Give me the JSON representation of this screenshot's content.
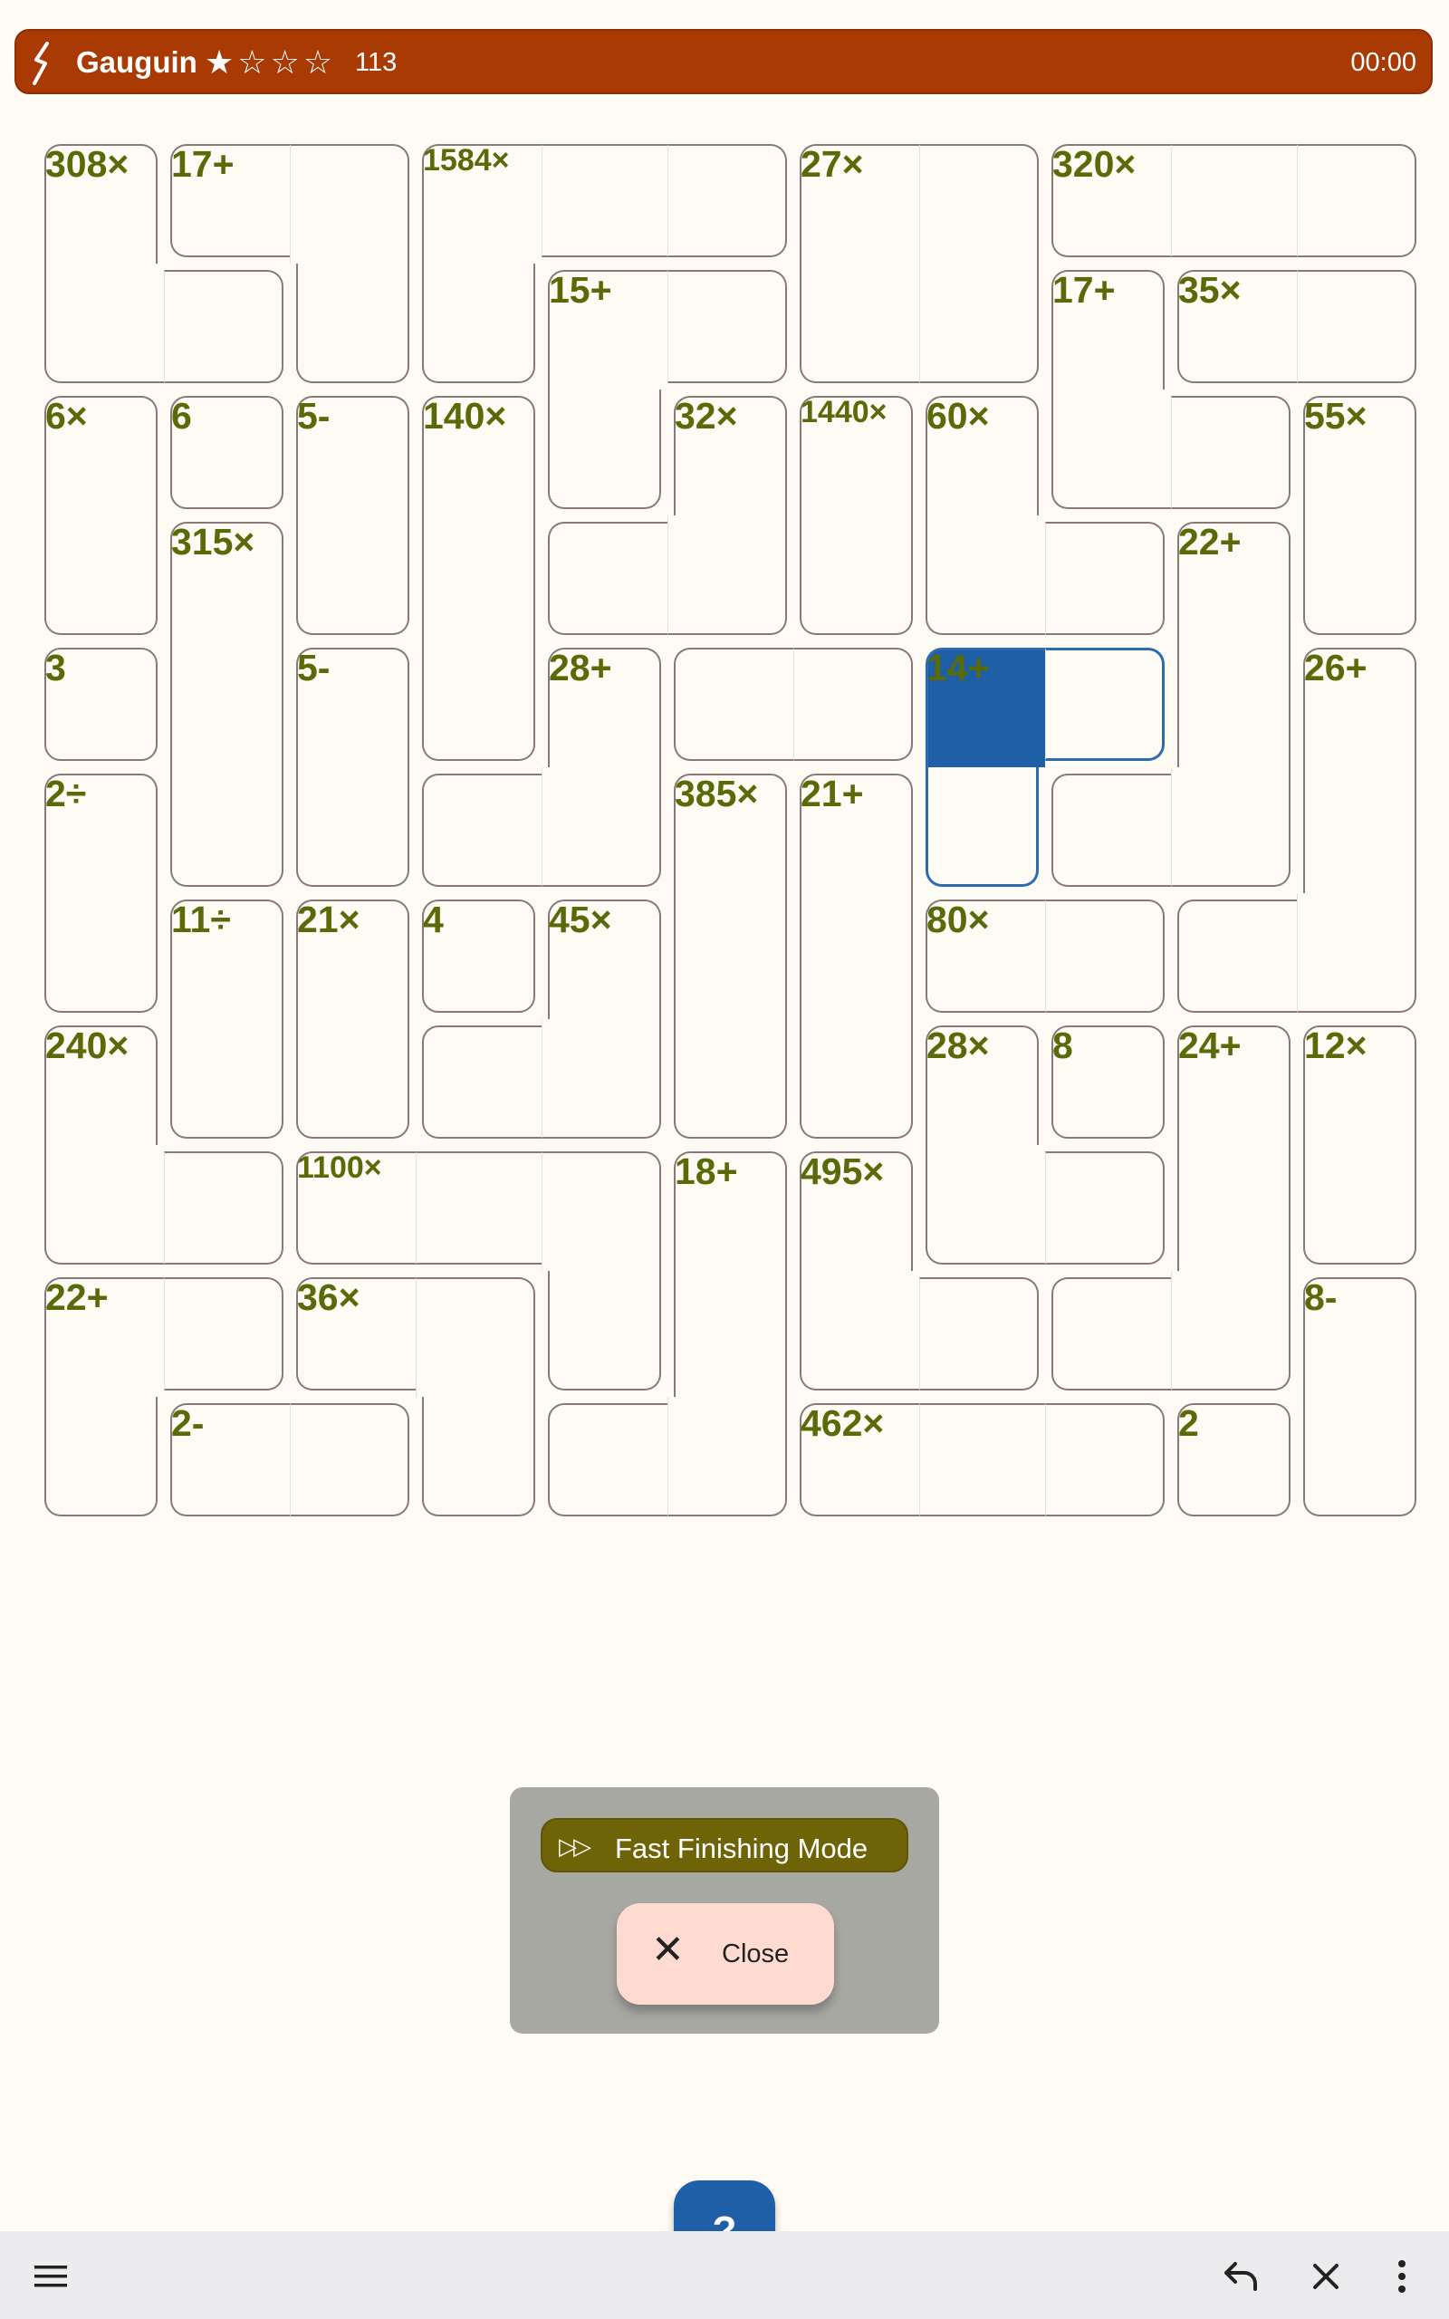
{
  "app": {
    "title": "Gauguin",
    "stars": "★☆☆☆",
    "count": "113",
    "timer": "00:00",
    "colors": {
      "bar": "#a93a03",
      "background": "#fdfbf4",
      "cage_label": "#5a6a08",
      "selected_cell": "#1f5fa8",
      "selected_cage_border": "#2c6bb0"
    }
  },
  "puzzle": {
    "size": 11,
    "selected_cell": {
      "row": 4,
      "col": 7
    },
    "cages": [
      {
        "label": "308×",
        "cells": [
          [
            0,
            0
          ],
          [
            1,
            0
          ],
          [
            1,
            1
          ]
        ]
      },
      {
        "label": "17+",
        "cells": [
          [
            0,
            1
          ],
          [
            0,
            2
          ],
          [
            1,
            2
          ]
        ]
      },
      {
        "label": "1584×",
        "cells": [
          [
            0,
            3
          ],
          [
            0,
            4
          ],
          [
            0,
            5
          ],
          [
            1,
            3
          ]
        ]
      },
      {
        "label": "27×",
        "cells": [
          [
            0,
            6
          ],
          [
            0,
            7
          ],
          [
            1,
            6
          ],
          [
            1,
            7
          ]
        ]
      },
      {
        "label": "320×",
        "cells": [
          [
            0,
            8
          ],
          [
            0,
            9
          ],
          [
            0,
            10
          ]
        ]
      },
      {
        "label": "15+",
        "cells": [
          [
            1,
            4
          ],
          [
            1,
            5
          ],
          [
            2,
            4
          ]
        ]
      },
      {
        "label": "17+",
        "cells": [
          [
            1,
            8
          ],
          [
            2,
            8
          ],
          [
            2,
            9
          ]
        ]
      },
      {
        "label": "35×",
        "cells": [
          [
            1,
            9
          ],
          [
            1,
            10
          ]
        ]
      },
      {
        "label": "6×",
        "cells": [
          [
            2,
            0
          ],
          [
            3,
            0
          ]
        ]
      },
      {
        "label": "6",
        "cells": [
          [
            2,
            1
          ]
        ]
      },
      {
        "label": "5-",
        "cells": [
          [
            2,
            2
          ],
          [
            3,
            2
          ]
        ]
      },
      {
        "label": "140×",
        "cells": [
          [
            2,
            3
          ],
          [
            3,
            3
          ],
          [
            4,
            3
          ]
        ]
      },
      {
        "label": "32×",
        "cells": [
          [
            2,
            5
          ],
          [
            3,
            4
          ],
          [
            3,
            5
          ]
        ]
      },
      {
        "label": "1440×",
        "cells": [
          [
            2,
            6
          ],
          [
            3,
            6
          ]
        ]
      },
      {
        "label": "60×",
        "cells": [
          [
            2,
            7
          ],
          [
            3,
            7
          ],
          [
            3,
            8
          ]
        ]
      },
      {
        "label": "55×",
        "cells": [
          [
            2,
            10
          ],
          [
            3,
            10
          ]
        ]
      },
      {
        "label": "315×",
        "cells": [
          [
            3,
            1
          ],
          [
            4,
            1
          ],
          [
            5,
            1
          ]
        ]
      },
      {
        "label": "22+",
        "cells": [
          [
            3,
            9
          ],
          [
            4,
            9
          ],
          [
            5,
            9
          ],
          [
            5,
            8
          ],
          [
            5,
            7
          ]
        ]
      },
      {
        "label": "3",
        "cells": [
          [
            4,
            0
          ]
        ]
      },
      {
        "label": "5-",
        "cells": [
          [
            4,
            2
          ],
          [
            5,
            2
          ]
        ]
      },
      {
        "label": "28+",
        "cells": [
          [
            4,
            4
          ],
          [
            5,
            4
          ],
          [
            5,
            3
          ]
        ]
      },
      {
        "label": "",
        "cells": [
          [
            4,
            5
          ],
          [
            4,
            6
          ]
        ]
      },
      {
        "label": "14+",
        "cells": [
          [
            4,
            7
          ],
          [
            4,
            8
          ],
          [
            5,
            7
          ]
        ]
      },
      {
        "label": "26+",
        "cells": [
          [
            4,
            10
          ],
          [
            5,
            10
          ],
          [
            6,
            10
          ],
          [
            6,
            9
          ]
        ]
      },
      {
        "label": "2÷",
        "cells": [
          [
            5,
            0
          ],
          [
            6,
            0
          ]
        ]
      },
      {
        "label": "385×",
        "cells": [
          [
            5,
            5
          ],
          [
            6,
            5
          ],
          [
            7,
            5
          ]
        ]
      },
      {
        "label": "21+",
        "cells": [
          [
            5,
            6
          ],
          [
            6,
            6
          ],
          [
            7,
            6
          ]
        ]
      },
      {
        "label": "11÷",
        "cells": [
          [
            6,
            1
          ],
          [
            7,
            1
          ]
        ]
      },
      {
        "label": "21×",
        "cells": [
          [
            6,
            2
          ],
          [
            7,
            2
          ]
        ]
      },
      {
        "label": "4",
        "cells": [
          [
            6,
            3
          ]
        ]
      },
      {
        "label": "45×",
        "cells": [
          [
            6,
            4
          ],
          [
            7,
            3
          ],
          [
            7,
            4
          ]
        ]
      },
      {
        "label": "80×",
        "cells": [
          [
            6,
            7
          ],
          [
            6,
            8
          ]
        ]
      },
      {
        "label": "240×",
        "cells": [
          [
            7,
            0
          ],
          [
            8,
            0
          ],
          [
            8,
            1
          ]
        ]
      },
      {
        "label": "28×",
        "cells": [
          [
            7,
            7
          ],
          [
            8,
            7
          ],
          [
            8,
            8
          ]
        ]
      },
      {
        "label": "8",
        "cells": [
          [
            7,
            8
          ]
        ]
      },
      {
        "label": "24+",
        "cells": [
          [
            7,
            9
          ],
          [
            8,
            9
          ],
          [
            9,
            9
          ],
          [
            9,
            8
          ]
        ]
      },
      {
        "label": "12×",
        "cells": [
          [
            7,
            10
          ],
          [
            8,
            10
          ]
        ]
      },
      {
        "label": "1100×",
        "cells": [
          [
            8,
            2
          ],
          [
            8,
            3
          ],
          [
            8,
            4
          ],
          [
            9,
            4
          ]
        ]
      },
      {
        "label": "18+",
        "cells": [
          [
            8,
            5
          ],
          [
            9,
            5
          ],
          [
            10,
            5
          ],
          [
            10,
            4
          ]
        ]
      },
      {
        "label": "495×",
        "cells": [
          [
            8,
            6
          ],
          [
            9,
            6
          ],
          [
            9,
            7
          ]
        ]
      },
      {
        "label": "22+",
        "cells": [
          [
            9,
            0
          ],
          [
            9,
            1
          ],
          [
            10,
            0
          ]
        ]
      },
      {
        "label": "36×",
        "cells": [
          [
            9,
            2
          ],
          [
            9,
            3
          ],
          [
            10,
            3
          ]
        ]
      },
      {
        "label": "8-",
        "cells": [
          [
            9,
            10
          ],
          [
            10,
            10
          ]
        ]
      },
      {
        "label": "2-",
        "cells": [
          [
            10,
            1
          ],
          [
            10,
            2
          ]
        ]
      },
      {
        "label": "462×",
        "cells": [
          [
            10,
            6
          ],
          [
            10,
            7
          ],
          [
            10,
            8
          ]
        ]
      },
      {
        "label": "2",
        "cells": [
          [
            10,
            9
          ]
        ]
      }
    ]
  },
  "popup": {
    "fast_finishing_label": "Fast Finishing Mode",
    "fast_finishing_icon": "fast-forward-icon",
    "close_label": "Close",
    "close_icon": "close-icon"
  },
  "help_fab": {
    "label": "?"
  },
  "bottombar": {
    "menu_icon": "hamburger-menu-icon",
    "undo_icon": "undo-icon",
    "clear_icon": "close-icon",
    "more_icon": "more-vert-icon"
  }
}
